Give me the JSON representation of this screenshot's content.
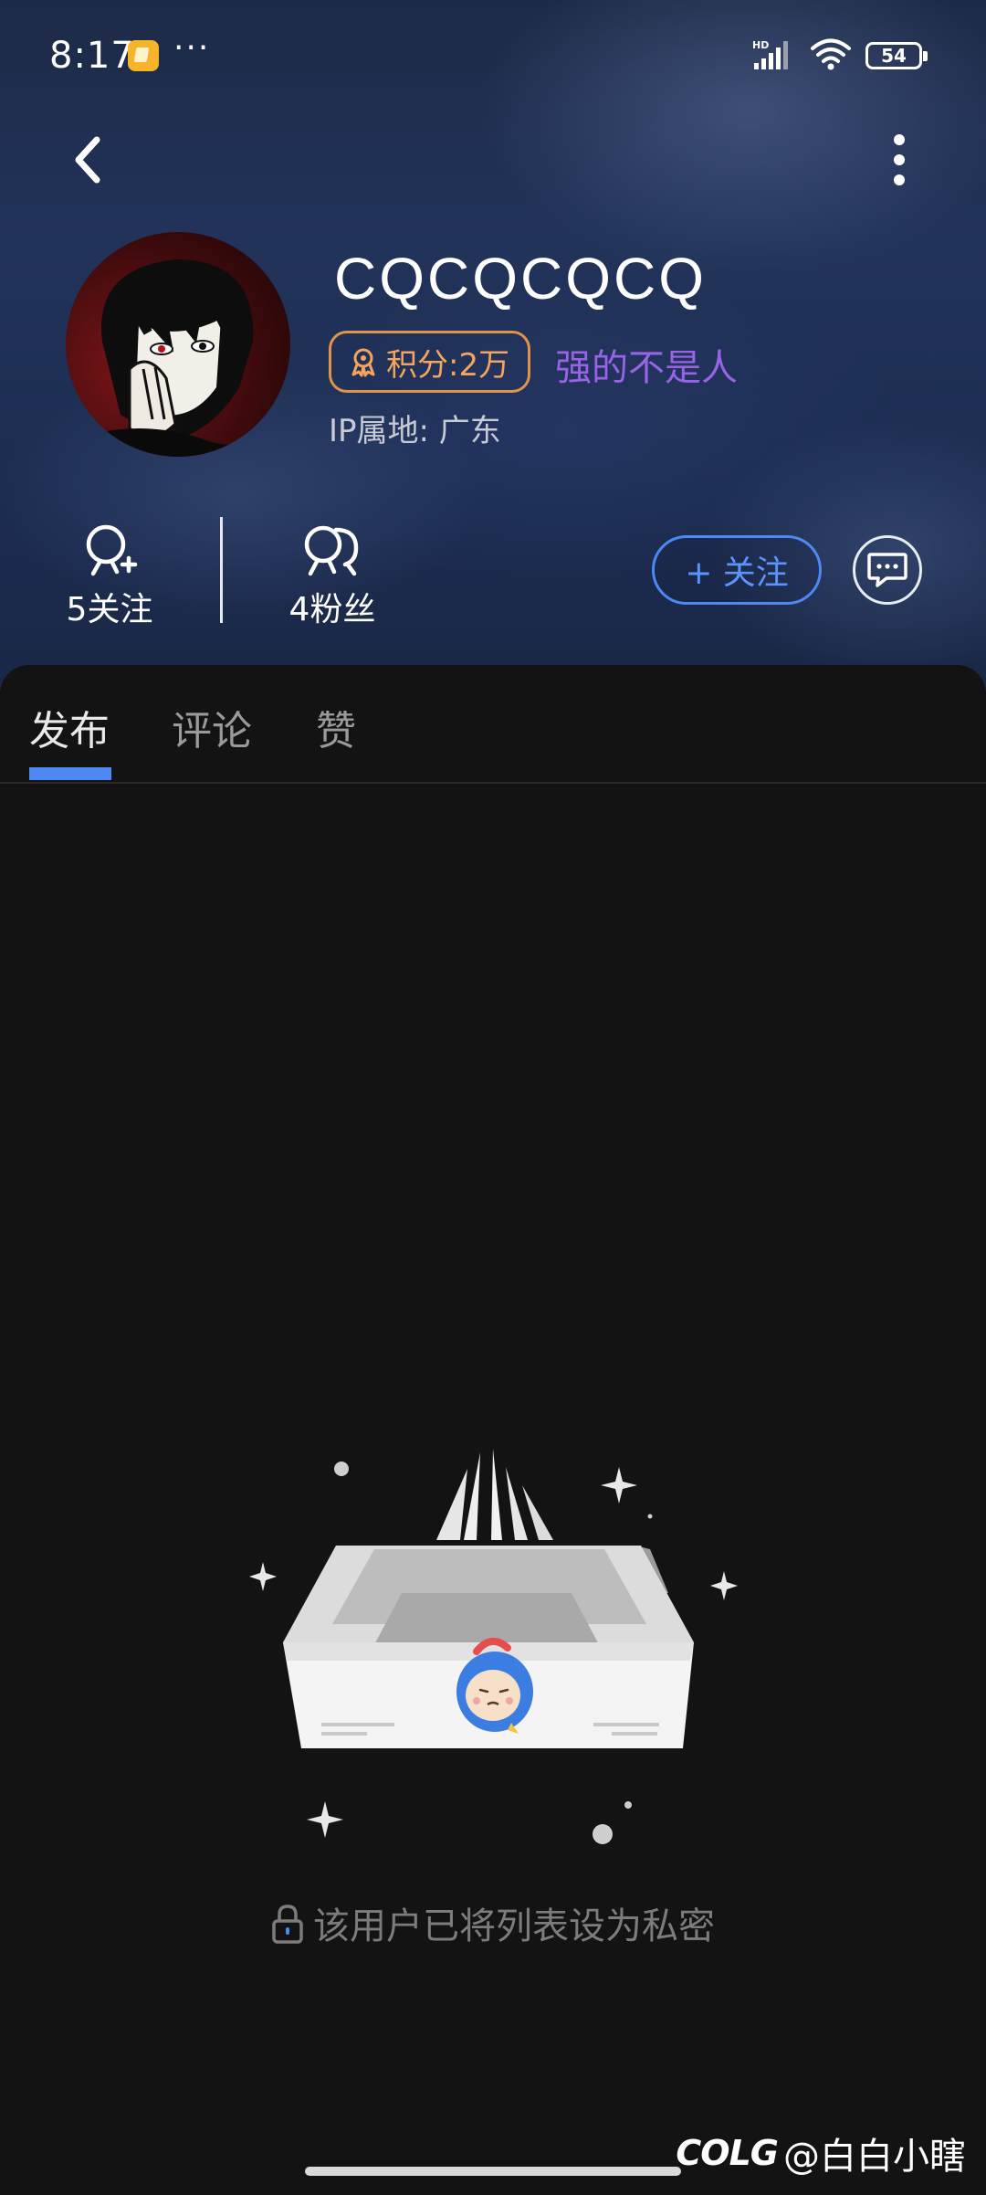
{
  "status_bar": {
    "time": "8:17",
    "more": "···",
    "signal_label": "HD",
    "battery": "54"
  },
  "profile": {
    "username": "CQCQCQCQ",
    "points": "积分:2万",
    "title": "强的不是人",
    "ip_location": "IP属地: 广东",
    "title_color": "#9a62e6",
    "points_color": "#f4a45c"
  },
  "stats": {
    "following": "5关注",
    "fans": "4粉丝"
  },
  "actions": {
    "follow_label": "+ 关注"
  },
  "tabs": [
    {
      "label": "发布",
      "active": true
    },
    {
      "label": "评论",
      "active": false
    },
    {
      "label": "赞",
      "active": false
    }
  ],
  "empty_state": {
    "message": "该用户已将列表设为私密"
  },
  "watermark": {
    "logo": "COLG",
    "handle": "@白白小瞎"
  },
  "colors": {
    "accent": "#4d88f4",
    "background": "#131313"
  },
  "icons": [
    "back-arrow-icon",
    "more-vertical-icon",
    "medal-icon",
    "user-plus-icon",
    "users-icon",
    "chat-bubble-icon",
    "lock-icon"
  ]
}
